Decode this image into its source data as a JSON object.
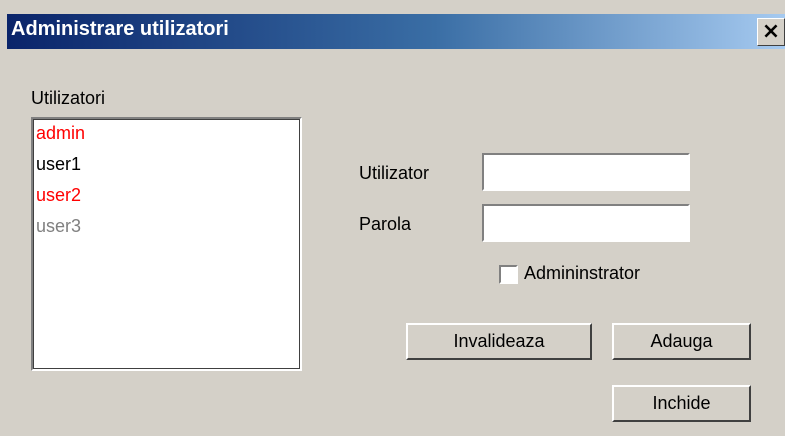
{
  "window": {
    "title": "Administrare utilizatori",
    "close_icon": "×",
    "colors": {
      "title_start": "#0a246a",
      "title_end": "#a6caf0",
      "face": "#d4d0c8"
    }
  },
  "users_panel": {
    "label": "Utilizatori",
    "items": [
      {
        "name": "admin",
        "color": "#ff0000"
      },
      {
        "name": "user1",
        "color": "#000000"
      },
      {
        "name": "user2",
        "color": "#ff0000"
      },
      {
        "name": "user3",
        "color": "#808080"
      }
    ]
  },
  "form": {
    "user_label": "Utilizator",
    "user_value": "",
    "password_label": "Parola",
    "password_value": "",
    "admin_checkbox_label": "Admininstrator",
    "admin_checked": false
  },
  "buttons": {
    "invalidate": "Invalideaza",
    "add": "Adauga",
    "close": "Inchide"
  }
}
